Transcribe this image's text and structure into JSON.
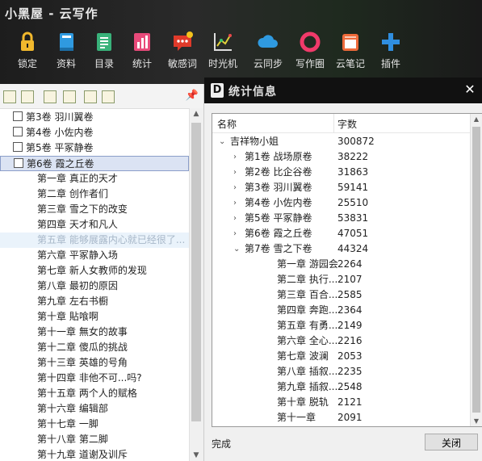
{
  "app": {
    "title": "小黑屋 - 云写作"
  },
  "toolbar": [
    {
      "label": "锁定",
      "icon": "lock-icon",
      "color": "#f1b82d"
    },
    {
      "label": "资料",
      "icon": "book-icon",
      "color": "#2f9ae0"
    },
    {
      "label": "目录",
      "icon": "list-doc-icon",
      "color": "#39b27a"
    },
    {
      "label": "统计",
      "icon": "stats-icon",
      "color": "#e84a7a"
    },
    {
      "label": "敏感词",
      "icon": "chat-alert-icon",
      "color": "#e03a2a"
    },
    {
      "label": "时光机",
      "icon": "chart-icon",
      "color": "#dddddd"
    },
    {
      "label": "云同步",
      "icon": "cloud-icon",
      "color": "#2f9ae0"
    },
    {
      "label": "写作圈",
      "icon": "ring-icon",
      "color": "#f03a6a"
    },
    {
      "label": "云笔记",
      "icon": "notebook-icon",
      "color": "#ee6a3a"
    },
    {
      "label": "插件",
      "icon": "plus-icon",
      "color": "#2f8ee0"
    }
  ],
  "left": {
    "volumes_top": [
      {
        "label": "第3卷 羽川翼卷"
      },
      {
        "label": "第4卷 小佐内卷"
      },
      {
        "label": "第5卷 平冢静卷"
      },
      {
        "label": "第6卷 霞之丘卷"
      }
    ],
    "chapters": [
      "第一章 真正的天才",
      "第二章 创作者们",
      "第三章 雪之下的改变",
      "第四章 天才和凡人",
      "第五章 能够展露内心就已经很了...",
      "第六章 平冢静入场",
      "第七章 新人女教师的发现",
      "第八章 最初的原因",
      "第九章 左右书橱",
      "第十章 貼喰啊",
      "第十一章 無女的故事",
      "第十二章 傻瓜的挑战",
      "第十三章 英雄的号角",
      "第十四章 非他不可...吗?",
      "第十五章 两个人的赋格",
      "第十六章 编辑部",
      "第十七章 一脚",
      "第十八章 第二脚",
      "第十九章 道谢及训斥"
    ]
  },
  "dialog": {
    "title": "统计信息",
    "col_name": "名称",
    "col_count": "字数",
    "rows": [
      {
        "level": 0,
        "arrow": "open",
        "name": "吉祥物小姐",
        "count": "300872"
      },
      {
        "level": 1,
        "arrow": "closed",
        "name": "第1卷 战场原卷",
        "count": "38222"
      },
      {
        "level": 1,
        "arrow": "closed",
        "name": "第2卷 比企谷卷",
        "count": "31863"
      },
      {
        "level": 1,
        "arrow": "closed",
        "name": "第3卷 羽川翼卷",
        "count": "59141"
      },
      {
        "level": 1,
        "arrow": "closed",
        "name": "第4卷 小佐内卷",
        "count": "25510"
      },
      {
        "level": 1,
        "arrow": "closed",
        "name": "第5卷 平冢静卷",
        "count": "53831"
      },
      {
        "level": 1,
        "arrow": "closed",
        "name": "第6卷 霞之丘卷",
        "count": "47051"
      },
      {
        "level": 1,
        "arrow": "open",
        "name": "第7卷 雪之下卷",
        "count": "44324"
      },
      {
        "level": 2,
        "arrow": "none",
        "name": "第一章 游园会",
        "count": "2264"
      },
      {
        "level": 2,
        "arrow": "none",
        "name": "第二章 执行...",
        "count": "2107"
      },
      {
        "level": 2,
        "arrow": "none",
        "name": "第三章 百合...",
        "count": "2585"
      },
      {
        "level": 2,
        "arrow": "none",
        "name": "第四章 奔跑...",
        "count": "2364"
      },
      {
        "level": 2,
        "arrow": "none",
        "name": "第五章 有勇...",
        "count": "2149"
      },
      {
        "level": 2,
        "arrow": "none",
        "name": "第六章 全心...",
        "count": "2216"
      },
      {
        "level": 2,
        "arrow": "none",
        "name": "第七章 波澜",
        "count": "2053"
      },
      {
        "level": 2,
        "arrow": "none",
        "name": "第八章 插叙...",
        "count": "2235"
      },
      {
        "level": 2,
        "arrow": "none",
        "name": "第九章 插叙...",
        "count": "2548"
      },
      {
        "level": 2,
        "arrow": "none",
        "name": "第十章 脱轨",
        "count": "2121"
      },
      {
        "level": 2,
        "arrow": "none",
        "name": "第十一章",
        "count": "2091"
      }
    ],
    "status": "完成",
    "close_label": "关闭"
  }
}
